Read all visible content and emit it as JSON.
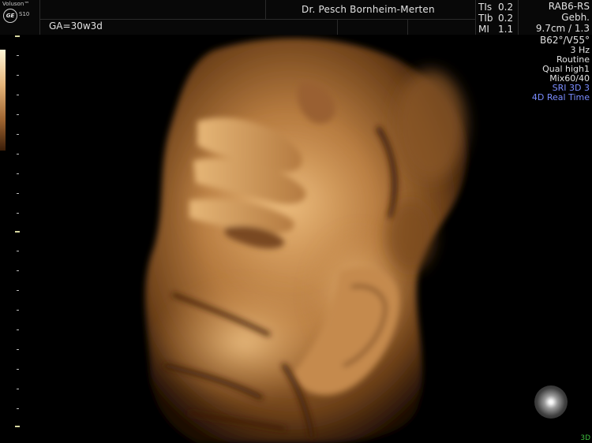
{
  "header": {
    "brand": "Voluson™",
    "model": "S10",
    "ga": "GA=30w3d",
    "doctor": "Dr.  Pesch Bornheim-Merten"
  },
  "safety": {
    "tis_label": "TIs",
    "tis_value": "0.2",
    "tib_label": "TIb",
    "tib_value": "0.2",
    "mi_label": "MI",
    "mi_value": "1.1"
  },
  "right_panel": {
    "probe": "RAB6-RS",
    "preset": "Gebh.",
    "depth": "9.7cm / 1.3",
    "angle": "B62°/V55°",
    "rate": "3 Hz",
    "mode": "Routine",
    "quality": "Qual high1",
    "mix": "Mix60/40",
    "sri": "SRI 3D 3",
    "realtime": "4D Real Time"
  },
  "footer": {
    "mode_label": "3D"
  },
  "colors": {
    "render_gold": "#c98e4e",
    "accent_blue": "#7a8cff",
    "mode_green": "#3fbf3f"
  }
}
